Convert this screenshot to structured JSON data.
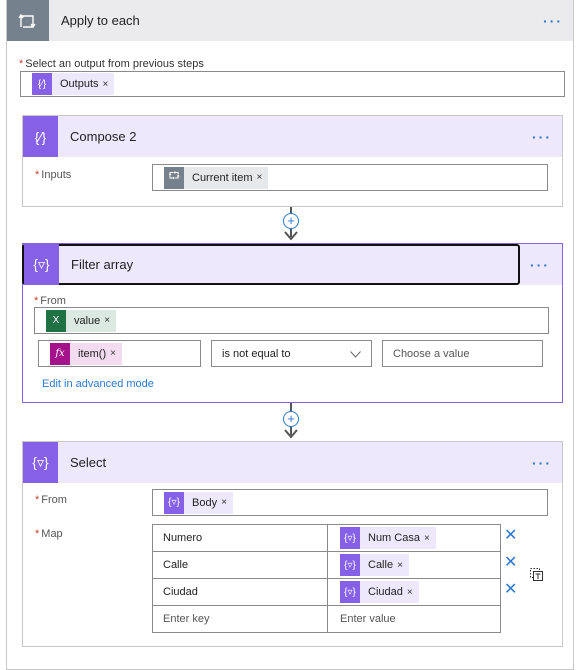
{
  "apply_to_each": {
    "title": "Apply to each",
    "icon": "loop-icon",
    "more_label": "···",
    "select_output_label": "Select an output from previous steps",
    "required_mark": "*",
    "output_token": {
      "label": "Outputs",
      "icon": "compose-icon",
      "remove": "×"
    }
  },
  "compose2": {
    "title": "Compose 2",
    "icon": "compose-icon",
    "more_label": "···",
    "inputs_label": "Inputs",
    "input_token": {
      "label": "Current item",
      "icon": "loop-icon",
      "remove": "×"
    }
  },
  "filter_array": {
    "title": "Filter array",
    "icon": "filter-icon",
    "more_label": "···",
    "from_label": "From",
    "from_token": {
      "label": "value",
      "icon": "excel-icon",
      "remove": "×"
    },
    "condition": {
      "left_token": {
        "label": "item()",
        "icon": "fx-icon",
        "remove": "×",
        "icon_text": "fx"
      },
      "operator": "is not equal to",
      "value_placeholder": "Choose a value"
    },
    "advanced_link": "Edit in advanced mode"
  },
  "select": {
    "title": "Select",
    "icon": "filter-icon",
    "more_label": "···",
    "from_label": "From",
    "from_token": {
      "label": "Body",
      "icon": "filter-icon",
      "remove": "×"
    },
    "map_label": "Map",
    "map_rows": [
      {
        "key": "Numero",
        "value": "Num Casa",
        "remove": "×"
      },
      {
        "key": "Calle",
        "value": "Calle",
        "remove": "×"
      },
      {
        "key": "Ciudad",
        "value": "Ciudad",
        "remove": "×"
      }
    ],
    "key_placeholder": "Enter key",
    "value_placeholder": "Enter value",
    "delete_row": "✕"
  },
  "colors": {
    "compose_purple": "#8661e8",
    "loop_gray": "#75818d",
    "excel_green": "#207245",
    "fx_magenta": "#a4138c",
    "link_blue": "#2b79d4"
  }
}
